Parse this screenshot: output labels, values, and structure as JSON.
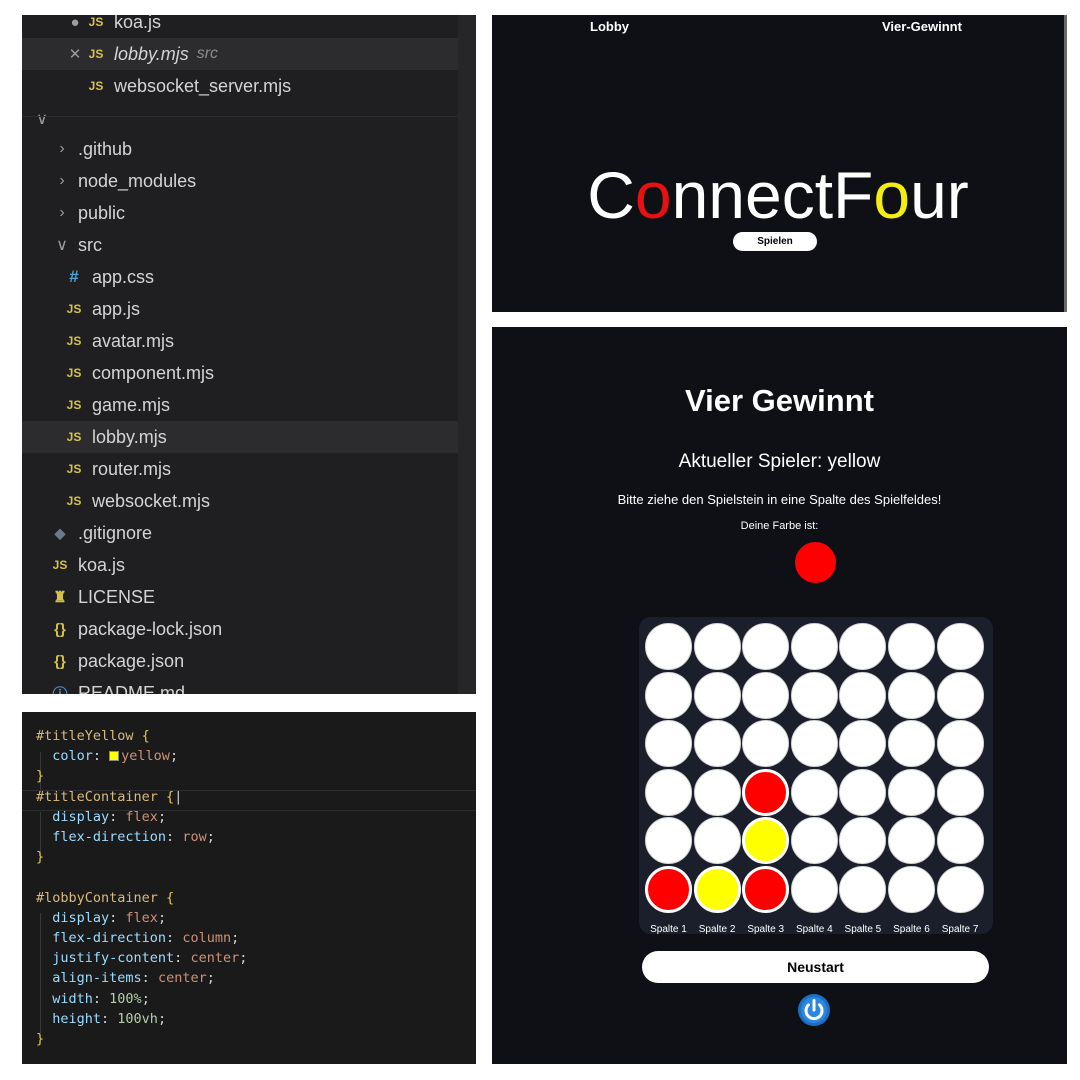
{
  "explorer": {
    "open_editors": [
      {
        "name": "koa.js",
        "icon": "js-icon",
        "state": "modified"
      },
      {
        "name": "lobby.mjs",
        "icon": "js-icon",
        "state": "close",
        "description": "src"
      },
      {
        "name": "websocket_server.mjs",
        "icon": "js-icon",
        "state": "none"
      }
    ],
    "tree": [
      {
        "name": ".github",
        "type": "folder",
        "expanded": false
      },
      {
        "name": "node_modules",
        "type": "folder",
        "expanded": false
      },
      {
        "name": "public",
        "type": "folder",
        "expanded": false
      },
      {
        "name": "src",
        "type": "folder",
        "expanded": true
      }
    ],
    "src_files": [
      {
        "name": "app.css",
        "icon": "css-icon"
      },
      {
        "name": "app.js",
        "icon": "js-icon"
      },
      {
        "name": "avatar.mjs",
        "icon": "js-icon"
      },
      {
        "name": "component.mjs",
        "icon": "js-icon"
      },
      {
        "name": "game.mjs",
        "icon": "js-icon"
      },
      {
        "name": "lobby.mjs",
        "icon": "js-icon",
        "selected": true
      },
      {
        "name": "router.mjs",
        "icon": "js-icon"
      },
      {
        "name": "websocket.mjs",
        "icon": "js-icon"
      }
    ],
    "root_files": [
      {
        "name": ".gitignore",
        "icon": "git-icon"
      },
      {
        "name": "koa.js",
        "icon": "js-icon"
      },
      {
        "name": "LICENSE",
        "icon": "license-icon"
      },
      {
        "name": "package-lock.json",
        "icon": "braces-icon"
      },
      {
        "name": "package.json",
        "icon": "braces-icon"
      },
      {
        "name": "README.md",
        "icon": "info-icon"
      }
    ],
    "icon_glyphs": {
      "js": "JS",
      "braces": "{}",
      "hash": "#"
    }
  },
  "lobby": {
    "nav_left": "Lobby",
    "nav_right": "Vier-Gewinnt",
    "title_segments": [
      {
        "text": "C",
        "color": "white"
      },
      {
        "text": "o",
        "color": "red"
      },
      {
        "text": "nnectF",
        "color": "white"
      },
      {
        "text": "o",
        "color": "yellow"
      },
      {
        "text": "ur",
        "color": "white"
      }
    ],
    "play_button": "Spielen"
  },
  "code": {
    "lines": [
      [
        {
          "t": "#titleYellow ",
          "c": "sel"
        },
        {
          "t": "{",
          "c": "br"
        }
      ],
      [
        {
          "t": "  color",
          "c": "prop"
        },
        {
          "t": ": ",
          "c": "pn"
        },
        {
          "t": "",
          "c": "swatch"
        },
        {
          "t": "yellow",
          "c": "val"
        },
        {
          "t": ";",
          "c": "pn"
        }
      ],
      [
        {
          "t": "}",
          "c": "br"
        }
      ],
      [
        {
          "t": "#titleContainer ",
          "c": "sel"
        },
        {
          "t": "{",
          "c": "br"
        },
        {
          "t": "|",
          "c": "pn"
        }
      ],
      [
        {
          "t": "  display",
          "c": "prop"
        },
        {
          "t": ": ",
          "c": "pn"
        },
        {
          "t": "flex",
          "c": "val"
        },
        {
          "t": ";",
          "c": "pn"
        }
      ],
      [
        {
          "t": "  flex-direction",
          "c": "prop"
        },
        {
          "t": ": ",
          "c": "pn"
        },
        {
          "t": "row",
          "c": "val"
        },
        {
          "t": ";",
          "c": "pn"
        }
      ],
      [
        {
          "t": "}",
          "c": "br"
        }
      ],
      [],
      [
        {
          "t": "#lobbyContainer ",
          "c": "sel"
        },
        {
          "t": "{",
          "c": "br"
        }
      ],
      [
        {
          "t": "  display",
          "c": "prop"
        },
        {
          "t": ": ",
          "c": "pn"
        },
        {
          "t": "flex",
          "c": "val"
        },
        {
          "t": ";",
          "c": "pn"
        }
      ],
      [
        {
          "t": "  flex-direction",
          "c": "prop"
        },
        {
          "t": ": ",
          "c": "pn"
        },
        {
          "t": "column",
          "c": "val"
        },
        {
          "t": ";",
          "c": "pn"
        }
      ],
      [
        {
          "t": "  justify-content",
          "c": "prop"
        },
        {
          "t": ": ",
          "c": "pn"
        },
        {
          "t": "center",
          "c": "val"
        },
        {
          "t": ";",
          "c": "pn"
        }
      ],
      [
        {
          "t": "  align-items",
          "c": "prop"
        },
        {
          "t": ": ",
          "c": "pn"
        },
        {
          "t": "center",
          "c": "val"
        },
        {
          "t": ";",
          "c": "pn"
        }
      ],
      [
        {
          "t": "  width",
          "c": "prop"
        },
        {
          "t": ": ",
          "c": "pn"
        },
        {
          "t": "100%",
          "c": "num"
        },
        {
          "t": ";",
          "c": "pn"
        }
      ],
      [
        {
          "t": "  height",
          "c": "prop"
        },
        {
          "t": ": ",
          "c": "pn"
        },
        {
          "t": "100vh",
          "c": "num"
        },
        {
          "t": ";",
          "c": "pn"
        }
      ],
      [
        {
          "t": "}",
          "c": "br"
        }
      ]
    ]
  },
  "game": {
    "title": "Vier Gewinnt",
    "current_player": "Aktueller Spieler: yellow",
    "instruction": "Bitte ziehe den Spielstein in eine Spalte des Spielfeldes!",
    "color_label": "Deine Farbe ist:",
    "own_color": "#ff0000",
    "board": [
      [
        "empty",
        "empty",
        "empty",
        "empty",
        "empty",
        "empty",
        "empty"
      ],
      [
        "empty",
        "empty",
        "empty",
        "empty",
        "empty",
        "empty",
        "empty"
      ],
      [
        "empty",
        "empty",
        "empty",
        "empty",
        "empty",
        "empty",
        "empty"
      ],
      [
        "empty",
        "empty",
        "red",
        "empty",
        "empty",
        "empty",
        "empty"
      ],
      [
        "empty",
        "empty",
        "yellow",
        "empty",
        "empty",
        "empty",
        "empty"
      ],
      [
        "red",
        "yellow",
        "red",
        "empty",
        "empty",
        "empty",
        "empty"
      ]
    ],
    "column_labels": [
      "Spalte 1",
      "Spalte 2",
      "Spalte 3",
      "Spalte 4",
      "Spalte 5",
      "Spalte 6",
      "Spalte 7"
    ],
    "restart_button": "Neustart",
    "power_icon": "power-icon"
  },
  "colors": {
    "red": "#ff0000",
    "yellow": "#ffff00",
    "background": "#0e1016",
    "board": "#1b1f2c",
    "editor_bg": "#1f1f21"
  }
}
